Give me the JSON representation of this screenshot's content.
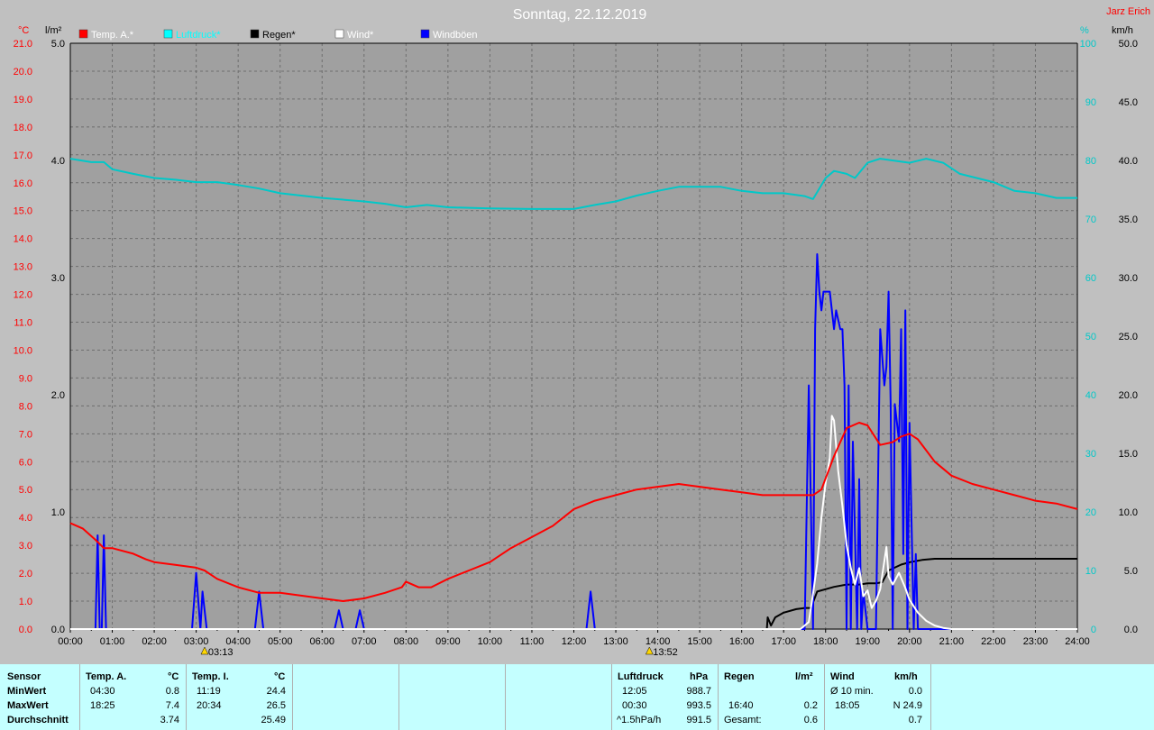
{
  "header": {
    "title": "Sonntag, 22.12.2019",
    "author": "Jarz Erich"
  },
  "colors": {
    "temp": "#ff0000",
    "pressure": "#00c8c8",
    "rain": "#000000",
    "wind": "#ffffff",
    "gust": "#0000ff",
    "background": "#c0c0c0",
    "stats_background": "#c4ffff"
  },
  "chart_data": {
    "type": "line",
    "x_domain": [
      0,
      24
    ],
    "x_ticks": [
      "00:00",
      "01:00",
      "02:00",
      "03:00",
      "04:00",
      "05:00",
      "06:00",
      "07:00",
      "08:00",
      "09:00",
      "10:00",
      "11:00",
      "12:00",
      "13:00",
      "14:00",
      "15:00",
      "16:00",
      "17:00",
      "18:00",
      "19:00",
      "20:00",
      "21:00",
      "22:00",
      "23:00",
      "24:00"
    ],
    "axes": {
      "temp": {
        "unit": "°C",
        "min": 0,
        "max": 21,
        "step": 1,
        "color": "#ff0000"
      },
      "rain": {
        "unit": "l/m²",
        "min": 0,
        "max": 5,
        "step": 1,
        "color": "#000000"
      },
      "pressure": {
        "unit": "%",
        "min": 0,
        "max": 100,
        "step": 10,
        "color": "#00c8c8"
      },
      "wind": {
        "unit": "km/h",
        "min": 0,
        "max": 50,
        "step": 5,
        "color": "#000000"
      }
    },
    "legend": [
      "Temp. A.*",
      "Luftdruck*",
      "Regen*",
      "Wind*",
      "Windböen"
    ],
    "markers": [
      {
        "x": 3.2,
        "label": "03:13"
      },
      {
        "x": 13.8,
        "label": "13:52"
      }
    ],
    "series": [
      {
        "name": "Temp. A.*",
        "axis": "temp",
        "color": "#ff0000",
        "points": [
          [
            0,
            3.8
          ],
          [
            0.3,
            3.6
          ],
          [
            0.6,
            3.2
          ],
          [
            0.8,
            2.9
          ],
          [
            1,
            2.9
          ],
          [
            1.5,
            2.7
          ],
          [
            1.8,
            2.5
          ],
          [
            2,
            2.4
          ],
          [
            2.5,
            2.3
          ],
          [
            3,
            2.2
          ],
          [
            3.2,
            2.1
          ],
          [
            3.5,
            1.8
          ],
          [
            4,
            1.5
          ],
          [
            4.5,
            1.3
          ],
          [
            5,
            1.3
          ],
          [
            5.5,
            1.2
          ],
          [
            6,
            1.1
          ],
          [
            6.5,
            1.0
          ],
          [
            7,
            1.1
          ],
          [
            7.5,
            1.3
          ],
          [
            7.9,
            1.5
          ],
          [
            8,
            1.7
          ],
          [
            8.3,
            1.5
          ],
          [
            8.6,
            1.5
          ],
          [
            9,
            1.8
          ],
          [
            9.5,
            2.1
          ],
          [
            10,
            2.4
          ],
          [
            10.5,
            2.9
          ],
          [
            11,
            3.3
          ],
          [
            11.5,
            3.7
          ],
          [
            12,
            4.3
          ],
          [
            12.5,
            4.6
          ],
          [
            13,
            4.8
          ],
          [
            13.5,
            5.0
          ],
          [
            14,
            5.1
          ],
          [
            14.5,
            5.2
          ],
          [
            15,
            5.1
          ],
          [
            15.5,
            5.0
          ],
          [
            16,
            4.9
          ],
          [
            16.5,
            4.8
          ],
          [
            17,
            4.8
          ],
          [
            17.5,
            4.8
          ],
          [
            17.7,
            4.8
          ],
          [
            17.9,
            5.0
          ],
          [
            18.2,
            6.2
          ],
          [
            18.5,
            7.2
          ],
          [
            18.8,
            7.4
          ],
          [
            19,
            7.3
          ],
          [
            19.3,
            6.6
          ],
          [
            19.6,
            6.7
          ],
          [
            19.8,
            6.9
          ],
          [
            20,
            7.0
          ],
          [
            20.2,
            6.8
          ],
          [
            20.6,
            6.0
          ],
          [
            21,
            5.5
          ],
          [
            21.5,
            5.2
          ],
          [
            22,
            5.0
          ],
          [
            22.5,
            4.8
          ],
          [
            23,
            4.6
          ],
          [
            23.5,
            4.5
          ],
          [
            24,
            4.3
          ]
        ]
      },
      {
        "name": "Luftdruck*",
        "axis": "pressure",
        "color": "#00c8c8",
        "points": [
          [
            0,
            80.3
          ],
          [
            0.5,
            79.7
          ],
          [
            0.8,
            79.7
          ],
          [
            1,
            78.5
          ],
          [
            1.5,
            77.7
          ],
          [
            2,
            77.0
          ],
          [
            2.5,
            76.7
          ],
          [
            3,
            76.3
          ],
          [
            3.5,
            76.3
          ],
          [
            4,
            75.8
          ],
          [
            4.5,
            75.2
          ],
          [
            5,
            74.4
          ],
          [
            6,
            73.6
          ],
          [
            7,
            73.0
          ],
          [
            7.5,
            72.6
          ],
          [
            8,
            72.0
          ],
          [
            8.5,
            72.4
          ],
          [
            9,
            72.0
          ],
          [
            10,
            71.8
          ],
          [
            11,
            71.7
          ],
          [
            12,
            71.7
          ],
          [
            12.5,
            72.4
          ],
          [
            13,
            73.0
          ],
          [
            13.5,
            74.0
          ],
          [
            14,
            74.8
          ],
          [
            14.5,
            75.5
          ],
          [
            15,
            75.5
          ],
          [
            15.5,
            75.5
          ],
          [
            16,
            74.8
          ],
          [
            16.5,
            74.4
          ],
          [
            17,
            74.4
          ],
          [
            17.5,
            73.9
          ],
          [
            17.7,
            73.4
          ],
          [
            18,
            77.0
          ],
          [
            18.2,
            78.2
          ],
          [
            18.5,
            77.7
          ],
          [
            18.7,
            77.0
          ],
          [
            19,
            79.6
          ],
          [
            19.3,
            80.3
          ],
          [
            20,
            79.6
          ],
          [
            20.4,
            80.3
          ],
          [
            20.8,
            79.6
          ],
          [
            21.2,
            77.7
          ],
          [
            22,
            76.3
          ],
          [
            22.5,
            74.8
          ],
          [
            23,
            74.4
          ],
          [
            23.5,
            73.6
          ],
          [
            24,
            73.6
          ]
        ]
      },
      {
        "name": "Regen*",
        "axis": "rain",
        "color": "#000000",
        "points": [
          [
            0,
            0
          ],
          [
            16.6,
            0
          ],
          [
            16.62,
            0.1
          ],
          [
            16.7,
            0.03
          ],
          [
            16.8,
            0.1
          ],
          [
            17.0,
            0.14
          ],
          [
            17.3,
            0.17
          ],
          [
            17.5,
            0.18
          ],
          [
            17.65,
            0.18
          ],
          [
            17.8,
            0.32
          ],
          [
            18.2,
            0.36
          ],
          [
            18.5,
            0.38
          ],
          [
            18.8,
            0.38
          ],
          [
            19.0,
            0.39
          ],
          [
            19.2,
            0.39
          ],
          [
            19.35,
            0.4
          ],
          [
            19.5,
            0.5
          ],
          [
            19.8,
            0.55
          ],
          [
            20.0,
            0.57
          ],
          [
            20.3,
            0.59
          ],
          [
            20.6,
            0.6
          ],
          [
            24,
            0.6
          ]
        ]
      },
      {
        "name": "Wind*",
        "axis": "wind",
        "color": "#ffffff",
        "points": [
          [
            0,
            0
          ],
          [
            17.4,
            0
          ],
          [
            17.5,
            0.3
          ],
          [
            17.6,
            0.6
          ],
          [
            17.7,
            3.0
          ],
          [
            17.8,
            5.6
          ],
          [
            17.9,
            9.5
          ],
          [
            18.0,
            12.5
          ],
          [
            18.1,
            14.6
          ],
          [
            18.15,
            18.2
          ],
          [
            18.2,
            17.8
          ],
          [
            18.3,
            13.5
          ],
          [
            18.4,
            10.5
          ],
          [
            18.5,
            7.2
          ],
          [
            18.6,
            5.2
          ],
          [
            18.7,
            3.8
          ],
          [
            18.8,
            5.2
          ],
          [
            18.9,
            2.8
          ],
          [
            19.0,
            3.3
          ],
          [
            19.1,
            1.8
          ],
          [
            19.2,
            2.4
          ],
          [
            19.3,
            3.4
          ],
          [
            19.45,
            7.0
          ],
          [
            19.5,
            4.5
          ],
          [
            19.6,
            3.8
          ],
          [
            19.75,
            4.8
          ],
          [
            19.9,
            3.5
          ],
          [
            20.0,
            2.5
          ],
          [
            20.2,
            1.4
          ],
          [
            20.4,
            0.7
          ],
          [
            20.6,
            0.3
          ],
          [
            20.8,
            0.1
          ],
          [
            21,
            0
          ],
          [
            24,
            0
          ]
        ]
      },
      {
        "name": "Windböen",
        "axis": "wind",
        "color": "#0000ff",
        "points": [
          [
            0,
            0
          ],
          [
            0.6,
            0
          ],
          [
            0.65,
            8.0
          ],
          [
            0.7,
            0
          ],
          [
            0.75,
            0
          ],
          [
            0.8,
            8.0
          ],
          [
            0.85,
            0
          ],
          [
            2.9,
            0
          ],
          [
            3.0,
            4.8
          ],
          [
            3.1,
            0
          ],
          [
            3.15,
            3.2
          ],
          [
            3.25,
            0
          ],
          [
            4.4,
            0
          ],
          [
            4.5,
            3.2
          ],
          [
            4.6,
            0
          ],
          [
            6.3,
            0
          ],
          [
            6.4,
            1.6
          ],
          [
            6.5,
            0
          ],
          [
            6.8,
            0
          ],
          [
            6.9,
            1.6
          ],
          [
            7.0,
            0
          ],
          [
            12.3,
            0
          ],
          [
            12.4,
            3.2
          ],
          [
            12.5,
            0
          ],
          [
            17.5,
            0
          ],
          [
            17.6,
            20.8
          ],
          [
            17.7,
            0
          ],
          [
            17.75,
            25.6
          ],
          [
            17.8,
            32.0
          ],
          [
            17.85,
            28.8
          ],
          [
            17.9,
            27.2
          ],
          [
            17.95,
            28.8
          ],
          [
            18.0,
            28.8
          ],
          [
            18.1,
            28.8
          ],
          [
            18.15,
            27.2
          ],
          [
            18.2,
            25.6
          ],
          [
            18.25,
            27.2
          ],
          [
            18.35,
            25.6
          ],
          [
            18.4,
            25.6
          ],
          [
            18.45,
            20.8
          ],
          [
            18.5,
            0
          ],
          [
            18.55,
            20.8
          ],
          [
            18.6,
            0
          ],
          [
            18.65,
            16.0
          ],
          [
            18.75,
            0
          ],
          [
            18.8,
            12.8
          ],
          [
            18.85,
            0
          ],
          [
            18.9,
            3.2
          ],
          [
            19.0,
            0
          ],
          [
            19.2,
            0
          ],
          [
            19.3,
            25.6
          ],
          [
            19.4,
            20.8
          ],
          [
            19.45,
            22.4
          ],
          [
            19.5,
            28.8
          ],
          [
            19.55,
            19.2
          ],
          [
            19.6,
            0
          ],
          [
            19.65,
            19.2
          ],
          [
            19.7,
            17.6
          ],
          [
            19.75,
            16.0
          ],
          [
            19.8,
            25.6
          ],
          [
            19.85,
            6.4
          ],
          [
            19.9,
            27.2
          ],
          [
            19.95,
            0
          ],
          [
            20.0,
            17.6
          ],
          [
            20.1,
            0
          ],
          [
            20.15,
            6.4
          ],
          [
            20.2,
            0
          ],
          [
            24,
            0
          ]
        ]
      }
    ]
  },
  "stats": {
    "headers": {
      "sensor": "Sensor",
      "temp_a": "Temp. A.",
      "temp_a_unit": "°C",
      "temp_i": "Temp. I.",
      "temp_i_unit": "°C",
      "pressure": "Luftdruck",
      "pressure_unit": "hPa",
      "rain": "Regen",
      "rain_unit": "l/m²",
      "wind": "Wind",
      "wind_unit": "km/h"
    },
    "rows": {
      "min": "MinWert",
      "max": "MaxWert",
      "avg": "Durchschnitt"
    },
    "temp_a": {
      "min_time": "04:30",
      "min_val": "0.8",
      "max_time": "18:25",
      "max_val": "7.4",
      "avg_val": "3.74"
    },
    "temp_i": {
      "min_time": "11:19",
      "min_val": "24.4",
      "max_time": "20:34",
      "max_val": "26.5",
      "avg_val": "25.49"
    },
    "pressure": {
      "min_time": "12:05",
      "min_val": "988.7",
      "max_time": "00:30",
      "max_val": "993.5",
      "avg_label": "^1.5hPa/h",
      "avg_val": "991.5"
    },
    "rain": {
      "max_time": "16:40",
      "max_val": "0.2",
      "total_label": "Gesamt:",
      "total_val": "0.6"
    },
    "wind": {
      "min_label": "Ø 10 min.",
      "min_val": "0.0",
      "max_time": "18:05",
      "max_val": "N 24.9",
      "avg_val": "0.7"
    }
  }
}
